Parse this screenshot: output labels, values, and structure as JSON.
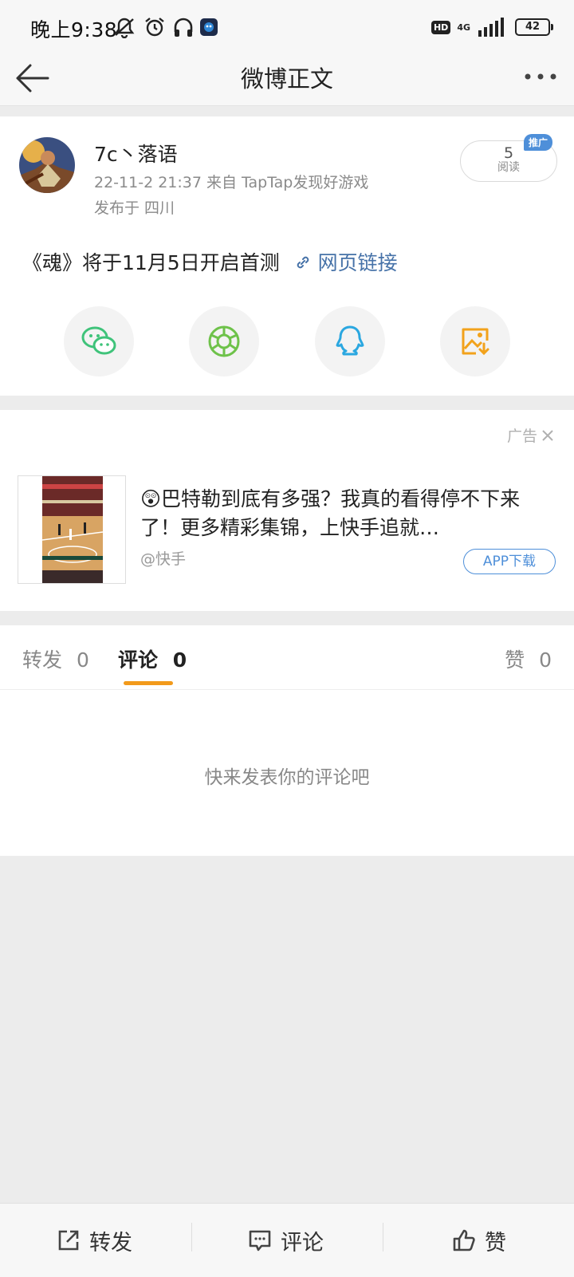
{
  "status": {
    "time": "晚上9:38",
    "hd": "HD",
    "network": "4G",
    "battery": "42"
  },
  "nav": {
    "title": "微博正文"
  },
  "post": {
    "username": "7c丶落语",
    "datetime_source": "22-11-2 21:37  来自 TapTap发现好游戏",
    "location": "发布于 四川",
    "read_count": "5",
    "read_label": "阅读",
    "promo_badge": "推广",
    "text": "《魂》将于11月5日开启首测",
    "link_text": "网页链接",
    "share_targets": [
      "wechat-icon",
      "moments-icon",
      "qq-icon",
      "save-image-icon"
    ]
  },
  "ad": {
    "label": "广告",
    "text": "😲巴特勒到底有多强？我真的看得停不下来了！更多精彩集锦，上快手追就…",
    "source": "@快手",
    "button": "APP下载"
  },
  "tabs": {
    "repost_label": "转发",
    "repost_count": "0",
    "comment_label": "评论",
    "comment_count": "0",
    "like_label": "赞",
    "like_count": "0"
  },
  "comments": {
    "empty_text": "快来发表你的评论吧"
  },
  "toolbar": {
    "repost": "转发",
    "comment": "评论",
    "like": "赞"
  },
  "colors": {
    "accent": "#f29a1b",
    "link": "#4672a8",
    "badge": "#4e8fd9",
    "wechat": "#3fc37a",
    "moments": "#6ec24a",
    "qq": "#2aa7e0",
    "save": "#f2a21b"
  }
}
